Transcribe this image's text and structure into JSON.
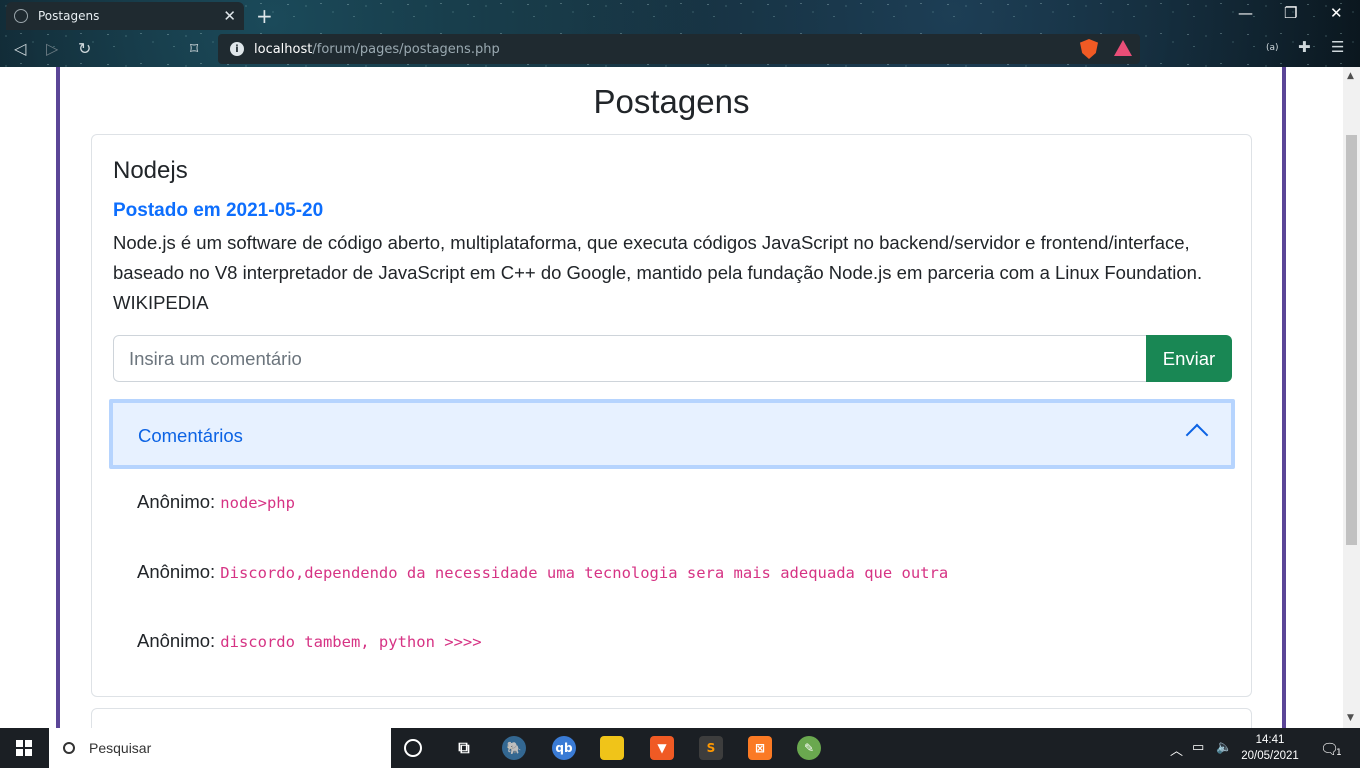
{
  "browser": {
    "tab_title": "Postagens",
    "tab_close": "✕",
    "new_tab": "+",
    "url_host": "localhost",
    "url_path": "/forum/pages/postagens.php",
    "window_controls": [
      "—",
      "❐",
      "✕"
    ]
  },
  "page": {
    "title": "Postagens",
    "post": {
      "title": "Nodejs",
      "date_text": "Postado em 2021-05-20",
      "body": "Node.js é um software de código aberto, multiplataforma, que executa códigos JavaScript no backend/servidor e frontend/interface, baseado no V8 interpretador de JavaScript em C++ do Google, mantido pela fundação Node.js em parceria com a Linux Foundation. WIKIPEDIA",
      "comment_placeholder": "Insira um comentário",
      "send_label": "Enviar",
      "accordion_label": "Comentários",
      "comments": [
        {
          "author": "Anônimo:",
          "text": "node>php"
        },
        {
          "author": "Anônimo:",
          "text": "Discordo,dependendo da necessidade uma tecnologia sera mais adequada que outra"
        },
        {
          "author": "Anônimo:",
          "text": "discordo tambem, python >>>>"
        }
      ]
    }
  },
  "taskbar": {
    "search_label": "Pesquisar",
    "time": "14:41",
    "date": "20/05/2021",
    "notification_count": "1"
  },
  "colors": {
    "primary": "#0d6efd",
    "success": "#198754",
    "accent_border": "#5b4597",
    "code": "#d63384"
  }
}
